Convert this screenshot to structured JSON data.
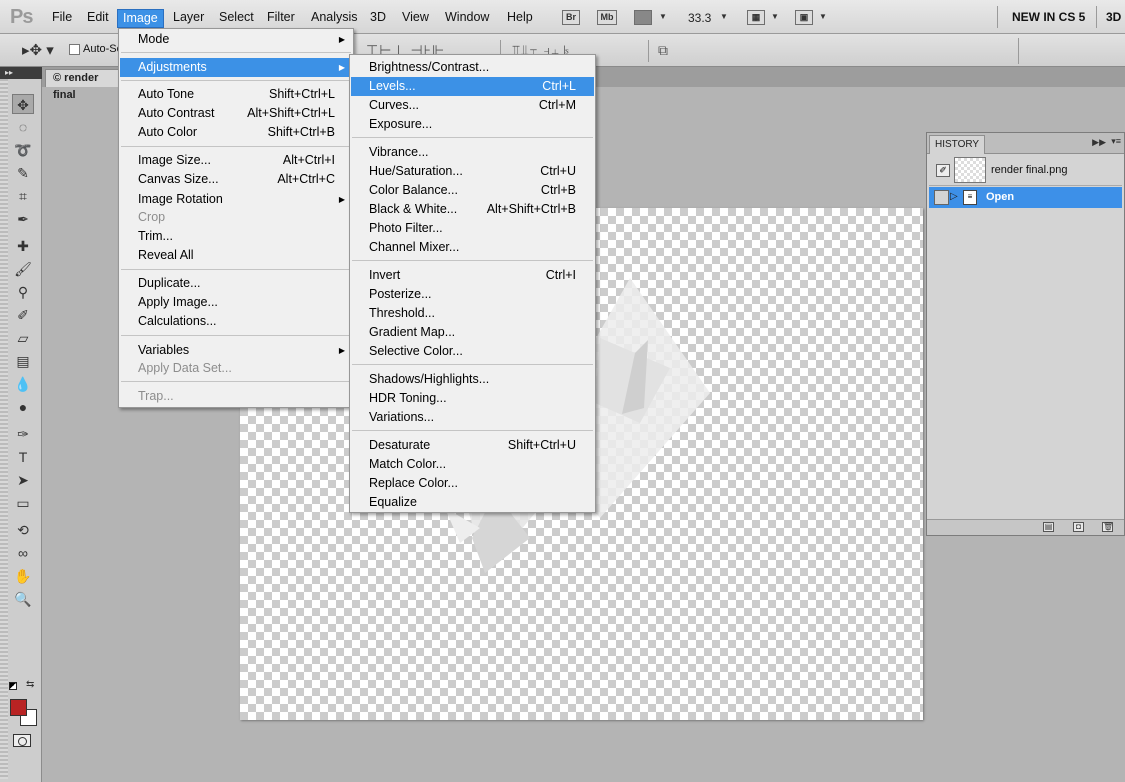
{
  "app": {
    "logo": "Ps"
  },
  "menubar": {
    "items": [
      "File",
      "Edit",
      "Image",
      "Layer",
      "Select",
      "Filter",
      "Analysis",
      "3D",
      "View",
      "Window",
      "Help"
    ],
    "active": "Image",
    "bridge_icon": "Br",
    "minibridge_icon": "Mb",
    "zoom": "33.3",
    "workspace": "NEW IN CS 5",
    "workspace_3d": "3D"
  },
  "options_bar": {
    "auto_select_label": "Auto-Se"
  },
  "document": {
    "tab_title": "© render final"
  },
  "image_menu": {
    "mode": "Mode",
    "adjustments": "Adjustments",
    "auto_tone": {
      "label": "Auto Tone",
      "shortcut": "Shift+Ctrl+L"
    },
    "auto_contrast": {
      "label": "Auto Contrast",
      "shortcut": "Alt+Shift+Ctrl+L"
    },
    "auto_color": {
      "label": "Auto Color",
      "shortcut": "Shift+Ctrl+B"
    },
    "image_size": {
      "label": "Image Size...",
      "shortcut": "Alt+Ctrl+I"
    },
    "canvas_size": {
      "label": "Canvas Size...",
      "shortcut": "Alt+Ctrl+C"
    },
    "image_rotation": "Image Rotation",
    "crop": "Crop",
    "trim": "Trim...",
    "reveal_all": "Reveal All",
    "duplicate": "Duplicate...",
    "apply_image": "Apply Image...",
    "calculations": "Calculations...",
    "variables": "Variables",
    "apply_data_set": "Apply Data Set...",
    "trap": "Trap..."
  },
  "adjustments_menu": {
    "brightness_contrast": {
      "label": "Brightness/Contrast..."
    },
    "levels": {
      "label": "Levels...",
      "shortcut": "Ctrl+L"
    },
    "curves": {
      "label": "Curves...",
      "shortcut": "Ctrl+M"
    },
    "exposure": {
      "label": "Exposure..."
    },
    "vibrance": {
      "label": "Vibrance..."
    },
    "hue_saturation": {
      "label": "Hue/Saturation...",
      "shortcut": "Ctrl+U"
    },
    "color_balance": {
      "label": "Color Balance...",
      "shortcut": "Ctrl+B"
    },
    "black_white": {
      "label": "Black & White...",
      "shortcut": "Alt+Shift+Ctrl+B"
    },
    "photo_filter": {
      "label": "Photo Filter..."
    },
    "channel_mixer": {
      "label": "Channel Mixer..."
    },
    "invert": {
      "label": "Invert",
      "shortcut": "Ctrl+I"
    },
    "posterize": {
      "label": "Posterize..."
    },
    "threshold": {
      "label": "Threshold..."
    },
    "gradient_map": {
      "label": "Gradient Map..."
    },
    "selective_color": {
      "label": "Selective Color..."
    },
    "shadows_highlights": {
      "label": "Shadows/Highlights..."
    },
    "hdr_toning": {
      "label": "HDR Toning..."
    },
    "variations": {
      "label": "Variations..."
    },
    "desaturate": {
      "label": "Desaturate",
      "shortcut": "Shift+Ctrl+U"
    },
    "match_color": {
      "label": "Match Color..."
    },
    "replace_color": {
      "label": "Replace Color..."
    },
    "equalize": {
      "label": "Equalize"
    }
  },
  "history": {
    "tab": "HISTORY",
    "snapshot": "render final.png",
    "states": [
      "Open"
    ]
  },
  "colors": {
    "accent": "#3c91e6",
    "foreground_swatch": "#b82323",
    "background_swatch": "#ffffff"
  }
}
